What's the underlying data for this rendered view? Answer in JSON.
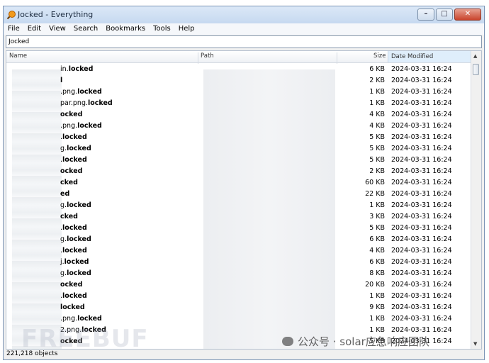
{
  "window": {
    "title": "Jocked - Everything"
  },
  "menu": [
    "File",
    "Edit",
    "View",
    "Search",
    "Bookmarks",
    "Tools",
    "Help"
  ],
  "search": {
    "value": "Jocked"
  },
  "columns": {
    "name": "Name",
    "path": "Path",
    "size": "Size",
    "date": "Date Modified"
  },
  "rows": [
    {
      "prefix": "in.",
      "suffix": "locked",
      "size": "6 KB",
      "date": "2024-03-31 16:24"
    },
    {
      "prefix": "",
      "suffix": "l",
      "size": "2 KB",
      "date": "2024-03-31 16:24"
    },
    {
      "prefix": ".png.",
      "suffix": "locked",
      "size": "1 KB",
      "date": "2024-03-31 16:24"
    },
    {
      "prefix": "par.png.",
      "suffix": "locked",
      "size": "1 KB",
      "date": "2024-03-31 16:24"
    },
    {
      "prefix": "",
      "suffix": "ocked",
      "size": "4 KB",
      "date": "2024-03-31 16:24"
    },
    {
      "prefix": ".png.",
      "suffix": "locked",
      "size": "4 KB",
      "date": "2024-03-31 16:24"
    },
    {
      "prefix": ".",
      "suffix": "locked",
      "size": "5 KB",
      "date": "2024-03-31 16:24"
    },
    {
      "prefix": "g.",
      "suffix": "locked",
      "size": "5 KB",
      "date": "2024-03-31 16:24"
    },
    {
      "prefix": ".",
      "suffix": "locked",
      "size": "5 KB",
      "date": "2024-03-31 16:24"
    },
    {
      "prefix": "",
      "suffix": "ocked",
      "size": "2 KB",
      "date": "2024-03-31 16:24"
    },
    {
      "prefix": "",
      "suffix": "cked",
      "size": "60 KB",
      "date": "2024-03-31 16:24"
    },
    {
      "prefix": "",
      "suffix": "ed",
      "size": "22 KB",
      "date": "2024-03-31 16:24"
    },
    {
      "prefix": "g.",
      "suffix": "locked",
      "size": "1 KB",
      "date": "2024-03-31 16:24"
    },
    {
      "prefix": "",
      "suffix": "cked",
      "size": "3 KB",
      "date": "2024-03-31 16:24"
    },
    {
      "prefix": ".",
      "suffix": "locked",
      "size": "5 KB",
      "date": "2024-03-31 16:24"
    },
    {
      "prefix": "g.",
      "suffix": "locked",
      "size": "6 KB",
      "date": "2024-03-31 16:24"
    },
    {
      "prefix": ".",
      "suffix": "locked",
      "size": "4 KB",
      "date": "2024-03-31 16:24"
    },
    {
      "prefix": "j.",
      "suffix": "locked",
      "size": "6 KB",
      "date": "2024-03-31 16:24"
    },
    {
      "prefix": "g.",
      "suffix": "locked",
      "size": "8 KB",
      "date": "2024-03-31 16:24"
    },
    {
      "prefix": "",
      "suffix": "ocked",
      "size": "20 KB",
      "date": "2024-03-31 16:24"
    },
    {
      "prefix": ".",
      "suffix": "locked",
      "size": "1 KB",
      "date": "2024-03-31 16:24"
    },
    {
      "prefix": "",
      "suffix": "locked",
      "size": "9 KB",
      "date": "2024-03-31 16:24"
    },
    {
      "prefix": ".png.",
      "suffix": "locked",
      "size": "1 KB",
      "date": "2024-03-31 16:24"
    },
    {
      "prefix": "2.png.",
      "suffix": "locked",
      "size": "1 KB",
      "date": "2024-03-31 16:24"
    },
    {
      "prefix": "",
      "suffix": "ocked",
      "size": "5 KB",
      "date": "2024-03-31 16:24"
    }
  ],
  "status": "221,218 objects",
  "watermark": {
    "left": "FREEBUF",
    "right": "公众号 · solar应急响应团队"
  }
}
